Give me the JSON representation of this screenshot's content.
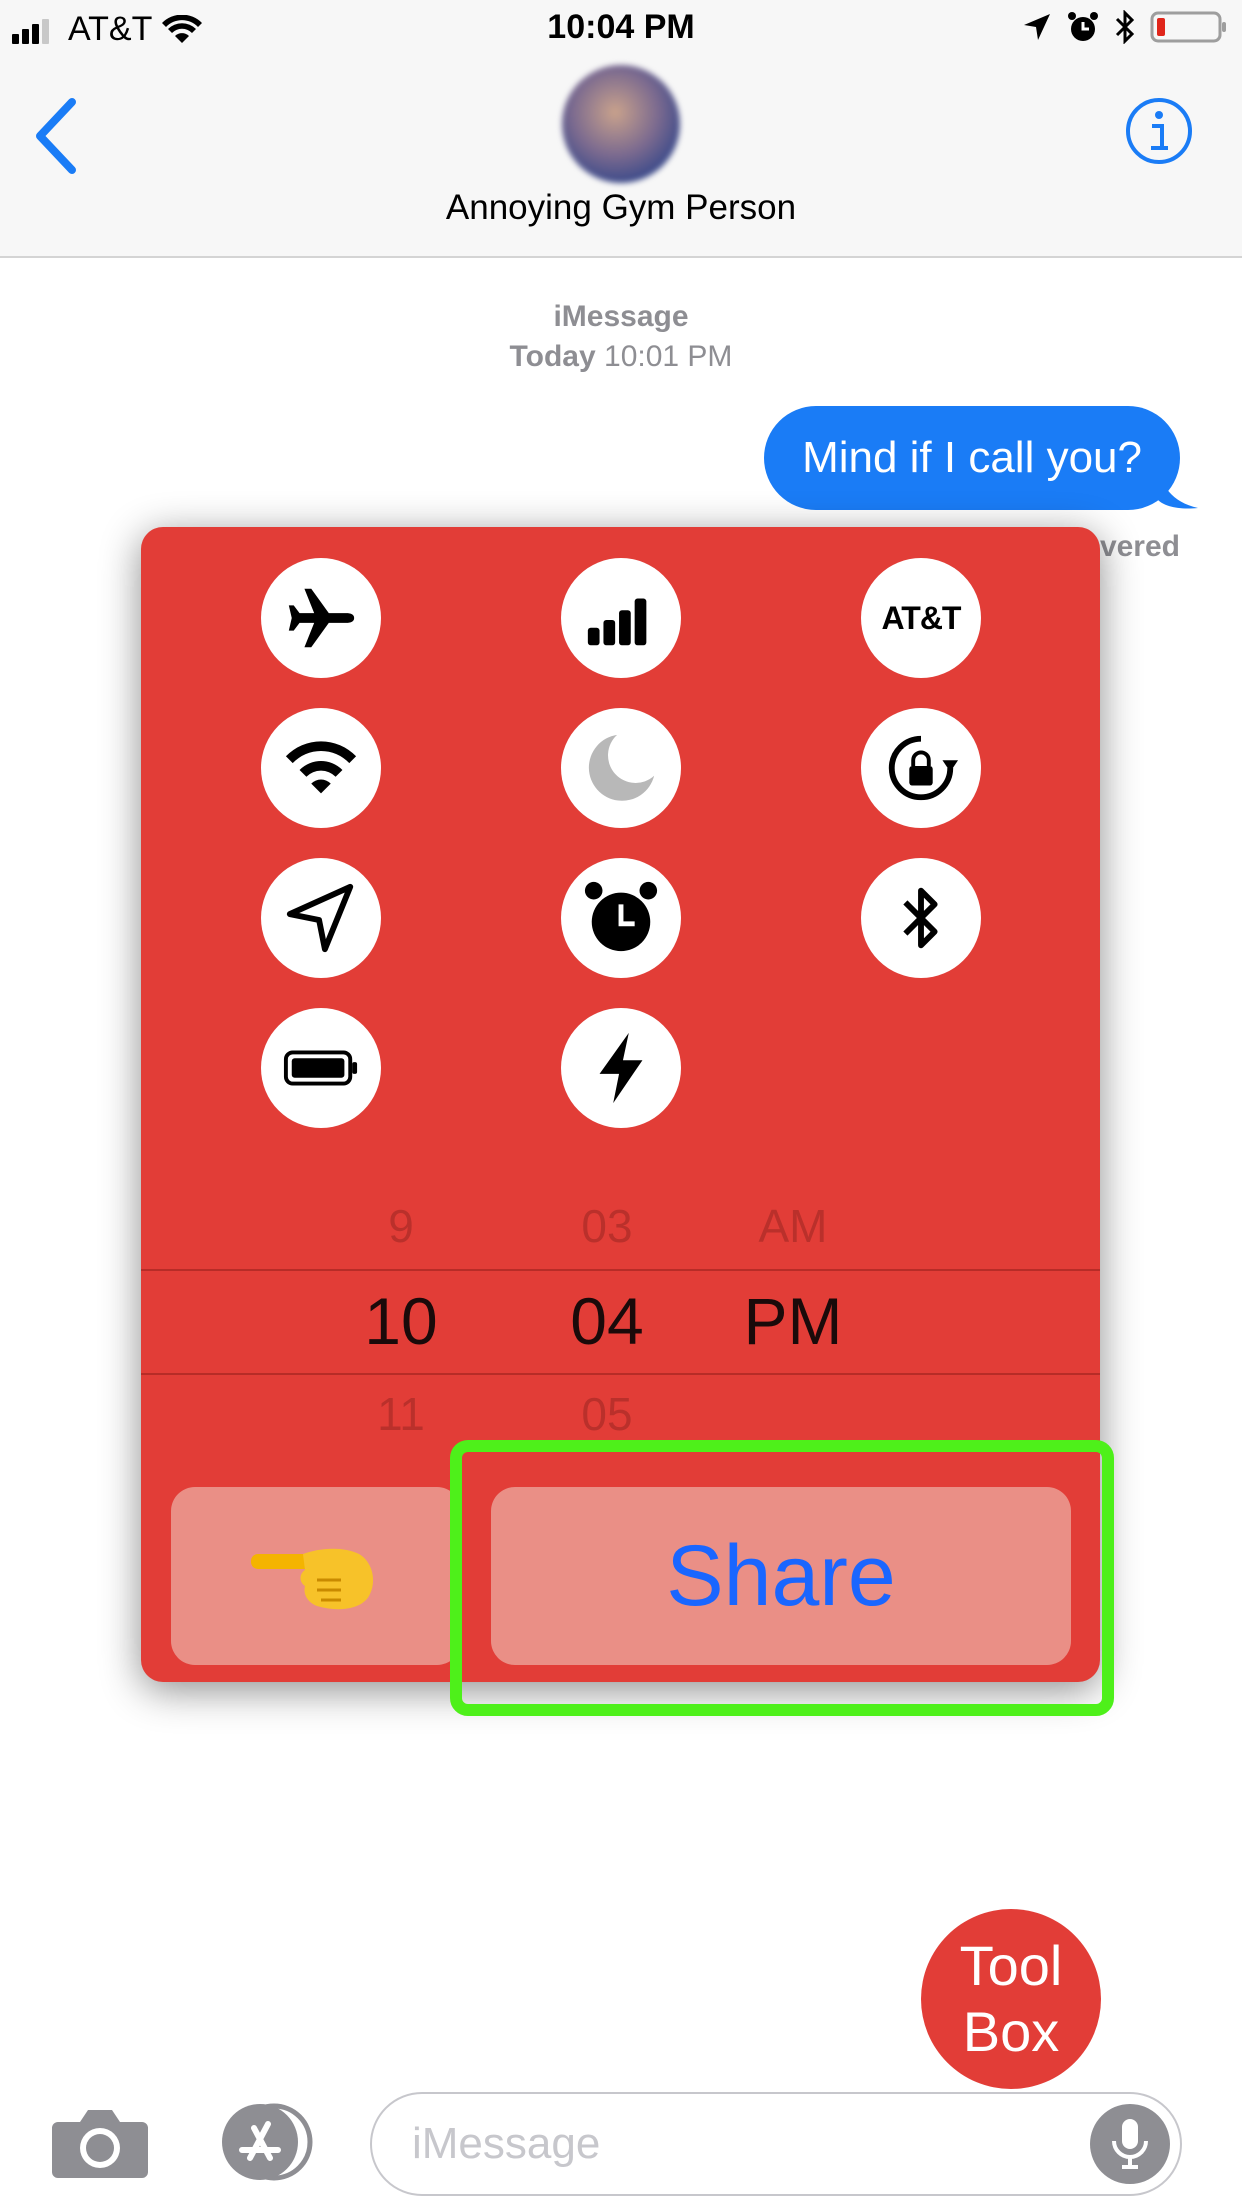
{
  "status_bar": {
    "carrier": "AT&T",
    "time": "10:04 PM"
  },
  "header": {
    "contact_name": "Annoying Gym Person"
  },
  "conversation": {
    "service": "iMessage",
    "timestamp_day": "Today",
    "timestamp_time": "10:01 PM",
    "sent_message": "Mind if I call you?",
    "status_partial": "vered"
  },
  "overlay": {
    "icons": [
      {
        "name": "airplane-icon"
      },
      {
        "name": "cellular-signal-icon"
      },
      {
        "name": "carrier-icon",
        "label": "AT&T"
      },
      {
        "name": "wifi-icon"
      },
      {
        "name": "moon-icon"
      },
      {
        "name": "rotation-lock-icon"
      },
      {
        "name": "location-arrow-icon"
      },
      {
        "name": "alarm-clock-icon"
      },
      {
        "name": "bluetooth-icon"
      },
      {
        "name": "battery-icon"
      },
      {
        "name": "lightning-bolt-icon"
      }
    ],
    "picker": {
      "hour_prev": "9",
      "hour": "10",
      "hour_next": "11",
      "minute_prev": "03",
      "minute": "04",
      "minute_next": "05",
      "ampm_prev": "AM",
      "ampm": "PM"
    },
    "hand_emoji": "👈",
    "share_label": "Share"
  },
  "toolbox": {
    "line1": "Tool",
    "line2": "Box"
  },
  "input_bar": {
    "placeholder": "iMessage"
  },
  "colors": {
    "accent_blue": "#1a7cf6",
    "panel_red": "#e23d37",
    "highlight_green": "#4ef01a"
  }
}
